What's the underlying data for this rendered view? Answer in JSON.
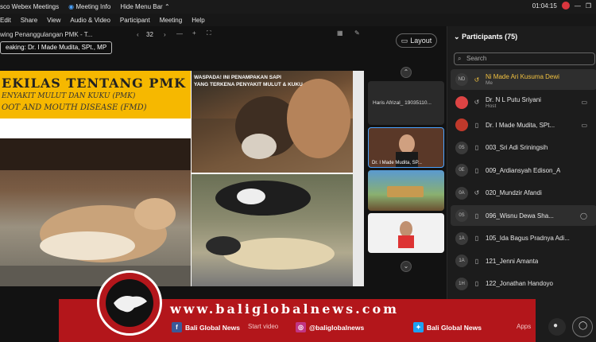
{
  "app": {
    "title": "sco Webex Meetings",
    "meeting_info": "Meeting Info",
    "hide_menu": "Hide Menu Bar",
    "time": "01:04:15"
  },
  "menu": [
    "Edit",
    "Share",
    "View",
    "Audio & Video",
    "Participant",
    "Meeting",
    "Help"
  ],
  "share": {
    "viewing": "wing Penanggulangan PMK - T...",
    "page": "32"
  },
  "speaking": "eaking: Dr. I Made Mudita, SPt., MP",
  "layout_label": "Layout",
  "slide": {
    "title": "EKILAS TENTANG PMK",
    "line2": "ENYAKIT MULUT DAN KUKU (PMK)",
    "line3": "OOT AND MOUTH DISEASE (FMD)",
    "warning_line1": "WASPADA! INI PENAMPAKAN SAPI",
    "warning_line2": "YANG TERKENA PENYAKIT MULUT & KUKU"
  },
  "thumbs": [
    {
      "name": "Haris Afrizal_ 19035110..."
    },
    {
      "name": "Dr. I Made Mudita, SP..."
    },
    {
      "name": ""
    },
    {
      "name": ""
    }
  ],
  "participants": {
    "header": "Participants (75)",
    "search_placeholder": "Search",
    "list": [
      {
        "initials": "ND",
        "name": "Ni Made Ari Kusuma Dewi",
        "sub": "Me",
        "highlight": true,
        "name_color": "#f0c040"
      },
      {
        "initials": "",
        "name": "Dr. N L Putu Sriyani",
        "sub": "Host",
        "highlight": false,
        "name_color": "#e6e6e6"
      },
      {
        "initials": "",
        "name": "Dr. I Made Mudita, SPt...",
        "sub": "",
        "highlight": false,
        "name_color": "#e6e6e6"
      },
      {
        "initials": "0S",
        "name": "003_Sri Adi Sriningsih",
        "sub": "",
        "highlight": false,
        "name_color": "#e6e6e6"
      },
      {
        "initials": "0E",
        "name": "009_Ardiansyah Edison_A",
        "sub": "",
        "highlight": false,
        "name_color": "#e6e6e6"
      },
      {
        "initials": "0A",
        "name": "020_Mundzir Afandi",
        "sub": "",
        "highlight": false,
        "name_color": "#e6e6e6"
      },
      {
        "initials": "0S",
        "name": "096_Wisnu Dewa Sha...",
        "sub": "",
        "highlight": true,
        "name_color": "#e6e6e6"
      },
      {
        "initials": "1A",
        "name": "105_Ida Bagus Pradnya Adi...",
        "sub": "",
        "highlight": false,
        "name_color": "#e6e6e6"
      },
      {
        "initials": "1A",
        "name": "121_Jenni Amanta",
        "sub": "",
        "highlight": false,
        "name_color": "#e6e6e6"
      },
      {
        "initials": "1H",
        "name": "122_Jonathan Handoyo",
        "sub": "",
        "highlight": false,
        "name_color": "#e6e6e6"
      }
    ]
  },
  "banner": {
    "url": "www.baliglobalnews.com",
    "facebook": "Bali Global News",
    "instagram": "@baliglobalnews",
    "twitter": "Bali Global News",
    "start_video": "Start video",
    "apps": "Apps"
  },
  "colors": {
    "banner_red": "#b3161b",
    "panel_bg": "#1c1c1c",
    "slide_yellow": "#f6b800"
  }
}
